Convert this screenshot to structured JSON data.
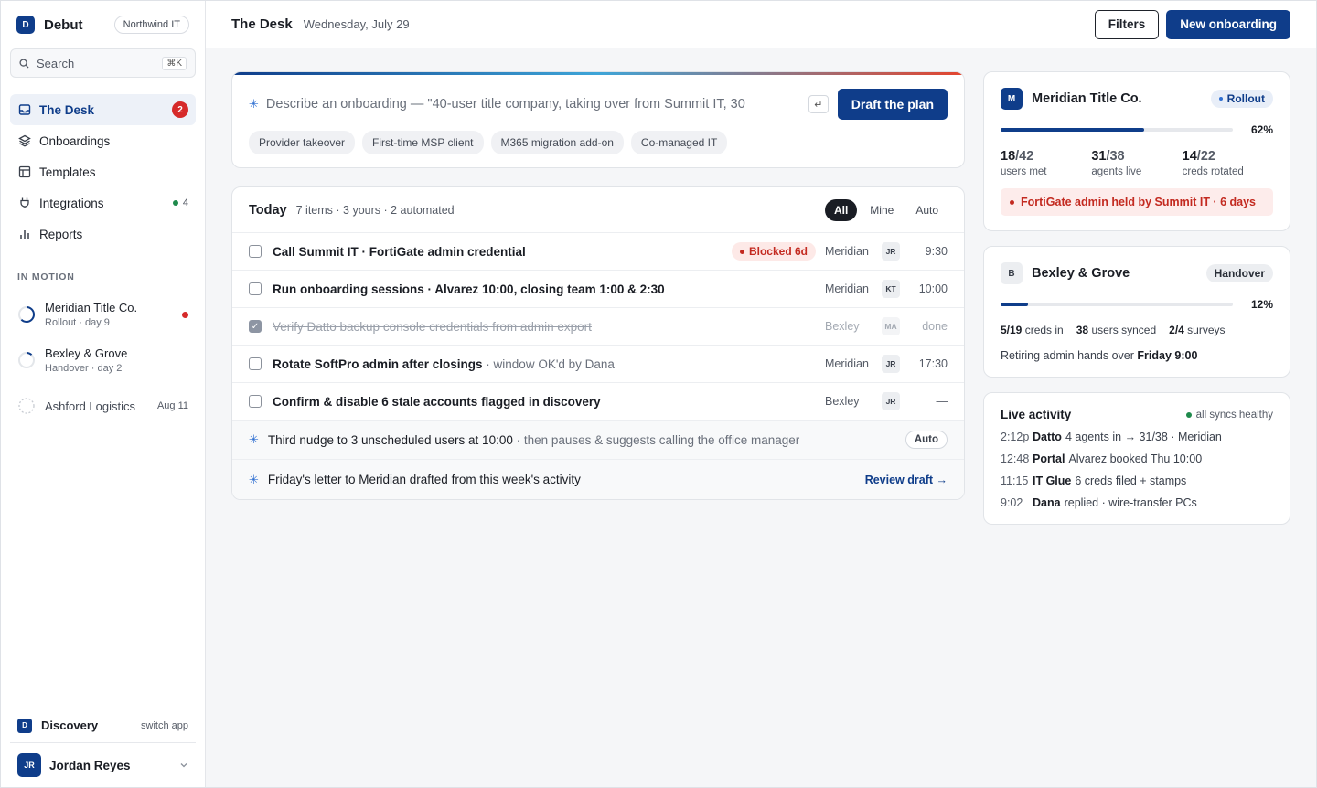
{
  "brand": {
    "initial": "D",
    "name": "Debut",
    "org": "Northwind IT"
  },
  "search": {
    "label": "Search",
    "shortcut": "⌘K"
  },
  "nav": [
    {
      "label": "The Desk",
      "icon": "inbox-icon",
      "badge": "2",
      "active": true
    },
    {
      "label": "Onboardings",
      "icon": "layers-icon"
    },
    {
      "label": "Templates",
      "icon": "template-icon"
    },
    {
      "label": "Integrations",
      "icon": "plug-icon",
      "count": "4"
    },
    {
      "label": "Reports",
      "icon": "bar-chart-icon"
    }
  ],
  "in_motion": {
    "label": "IN MOTION",
    "items": [
      {
        "name": "Meridian Title Co.",
        "sub": "Rollout · day 9",
        "progress": 0.62,
        "alert": true
      },
      {
        "name": "Bexley & Grove",
        "sub": "Handover · day 2",
        "progress": 0.12
      },
      {
        "name": "Ashford Logistics",
        "date": "Aug 11",
        "progress": 0
      }
    ]
  },
  "discovery": {
    "initial": "D",
    "name": "Discovery",
    "switch": "switch app"
  },
  "user": {
    "initials": "JR",
    "name": "Jordan Reyes"
  },
  "topbar": {
    "title": "The Desk",
    "date": "Wednesday, July 29",
    "filters": "Filters",
    "new": "New onboarding"
  },
  "composer": {
    "placeholder": "Describe an onboarding — \"40-user title company, taking over from Summit IT, 30",
    "enter": "↵",
    "cta": "Draft the plan",
    "chips": [
      "Provider takeover",
      "First-time MSP client",
      "M365 migration add-on",
      "Co-managed IT"
    ]
  },
  "today": {
    "title": "Today",
    "summary": "7 items · 3 yours · 2 automated",
    "filters": [
      "All",
      "Mine",
      "Auto"
    ],
    "tasks": [
      {
        "title": "Call Summit IT · FortiGate admin credential",
        "note": "",
        "blocked": "Blocked 6d",
        "client": "Meridian",
        "initials": "JR",
        "time": "9:30",
        "done": false
      },
      {
        "title": "Run onboarding sessions · Alvarez 10:00, closing team 1:00 & 2:30",
        "note": "",
        "client": "Meridian",
        "initials": "KT",
        "time": "10:00",
        "done": false
      },
      {
        "title": "Verify Datto backup console credentials from admin export",
        "note": "",
        "client": "Bexley",
        "initials": "MA",
        "time": "done",
        "done": true
      },
      {
        "title": "Rotate SoftPro admin after closings",
        "note": " · window OK'd by Dana",
        "client": "Meridian",
        "initials": "JR",
        "time": "17:30",
        "done": false
      },
      {
        "title": "Confirm & disable 6 stale accounts flagged in discovery",
        "note": "",
        "client": "Bexley",
        "initials": "JR",
        "time": "—",
        "done": false
      }
    ],
    "auto": [
      {
        "title": "Third nudge to 3 unscheduled users at 10:00",
        "note": " · then pauses & suggests calling the office manager",
        "chip": "Auto"
      },
      {
        "title": "Friday's letter to Meridian drafted from this week's activity",
        "note": "",
        "link": "Review draft →"
      }
    ]
  },
  "meridian": {
    "initial": "M",
    "name": "Meridian Title Co.",
    "phase": "Rollout",
    "progress": 62,
    "pct": "62%",
    "stats": [
      {
        "v": "18",
        "d": "/42",
        "l": "users met"
      },
      {
        "v": "31",
        "d": "/38",
        "l": "agents live"
      },
      {
        "v": "14",
        "d": "/22",
        "l": "creds rotated"
      }
    ],
    "alert": "FortiGate admin held by Summit IT · 6 days"
  },
  "bexley": {
    "initial": "B",
    "name": "Bexley & Grove",
    "phase": "Handover",
    "progress": 12,
    "pct": "12%",
    "s1v": "5/19",
    "s1l": "creds in",
    "s2v": "38",
    "s2l": "users synced",
    "s3v": "2/4",
    "s3l": "surveys",
    "note_pre": "Retiring admin hands over ",
    "note_b": "Friday 9:00"
  },
  "live": {
    "title": "Live activity",
    "health": "all syncs healthy",
    "items": [
      {
        "tm": "2:12p",
        "src": "Datto",
        "txt": "4 agents in → 31/38 · Meridian"
      },
      {
        "tm": "12:48",
        "src": "Portal",
        "txt": "Alvarez booked Thu 10:00"
      },
      {
        "tm": "11:15",
        "src": "IT Glue",
        "txt": "6 creds filed + stamps"
      },
      {
        "tm": "9:02",
        "src": "Dana",
        "txt": "replied · wire-transfer PCs"
      }
    ]
  },
  "colors": {
    "brand": "#0f3d8a",
    "danger": "#d62a2a",
    "success": "#1f8a4c",
    "accent": "#2f6fd1"
  }
}
